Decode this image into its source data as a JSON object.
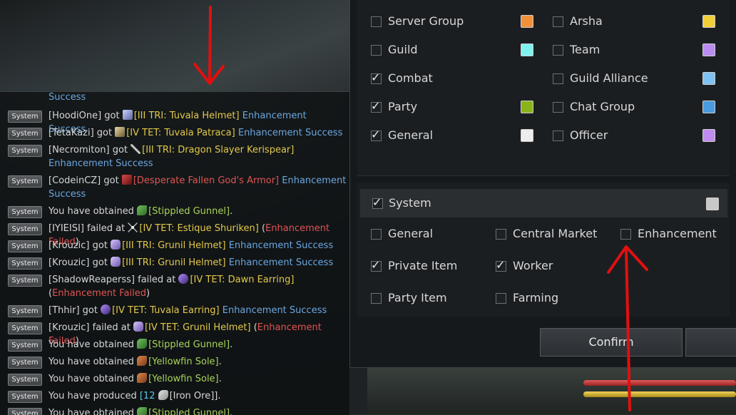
{
  "chat": {
    "lines": [
      {
        "tag": "System",
        "parts": [
          [
            "c-name",
            "[HoodiOne] got "
          ],
          [
            "ico helm",
            ""
          ],
          [
            "c-yellow",
            "[III TRI: Tuvala Helmet]"
          ],
          [
            "c-blue",
            " Enhancement Success"
          ]
        ]
      },
      {
        "tag": "System",
        "parts": [
          [
            "c-name",
            "[TetaKazi] got "
          ],
          [
            "ico boots",
            ""
          ],
          [
            "c-yellow",
            "[IV TET: Tuvala Patraca]"
          ],
          [
            "c-blue",
            " Enhancement Success"
          ]
        ]
      },
      {
        "tag": "System",
        "parts": [
          [
            "c-name",
            "[Necromiton] got "
          ],
          [
            "ico spear",
            ""
          ],
          [
            "c-yellow",
            "[III TRI: Dragon Slayer Kerispear]"
          ],
          [
            "c-blue",
            " Enhancement Success"
          ]
        ]
      },
      {
        "tag": "System",
        "parts": [
          [
            "c-name",
            "[CodeinCZ] got "
          ],
          [
            "ico armor",
            ""
          ],
          [
            "c-red",
            "[Desperate Fallen God's Armor]"
          ],
          [
            "c-blue",
            " Enhancement Success"
          ]
        ]
      },
      {
        "tag": "System",
        "parts": [
          [
            "c-name",
            "You have obtained "
          ],
          [
            "ico fish-g",
            ""
          ],
          [
            "c-green",
            "[Stippled Gunnel]"
          ],
          [
            "c-name",
            "."
          ]
        ]
      },
      {
        "tag": "System",
        "parts": [
          [
            "c-name",
            "[IYIEISI] failed at "
          ],
          [
            "ico shuriken",
            ""
          ],
          [
            "c-yellow",
            "[IV TET: Estique Shuriken]"
          ],
          [
            "c-name",
            " ("
          ],
          [
            "c-red",
            "Enhancement Failed"
          ],
          [
            "c-name",
            ")"
          ]
        ]
      },
      {
        "tag": "System",
        "parts": [
          [
            "c-name",
            "[Krouzic] got "
          ],
          [
            "ico crystal",
            ""
          ],
          [
            "c-yellow",
            "[III TRI: Grunil Helmet]"
          ],
          [
            "c-blue",
            " Enhancement Success"
          ]
        ]
      },
      {
        "tag": "System",
        "parts": [
          [
            "c-name",
            "[Krouzic] got "
          ],
          [
            "ico crystal",
            ""
          ],
          [
            "c-yellow",
            "[III TRI: Grunil Helmet]"
          ],
          [
            "c-blue",
            " Enhancement Success"
          ]
        ]
      },
      {
        "tag": "System",
        "parts": [
          [
            "c-name",
            "[ShadowReaperss] failed at "
          ],
          [
            "ico earring",
            ""
          ],
          [
            "c-yellow",
            "[IV TET: Dawn Earring]"
          ],
          [
            "c-name",
            " ("
          ],
          [
            "c-red",
            "Enhancement Failed"
          ],
          [
            "c-name",
            ")"
          ]
        ]
      },
      {
        "tag": "System",
        "parts": [
          [
            "c-name",
            "[Thhir] got "
          ],
          [
            "ico earring",
            ""
          ],
          [
            "c-yellow",
            "[IV TET: Tuvala Earring]"
          ],
          [
            "c-blue",
            " Enhancement Success"
          ]
        ]
      },
      {
        "tag": "System",
        "parts": [
          [
            "c-name",
            "[Krouzic] failed at "
          ],
          [
            "ico crystal",
            ""
          ],
          [
            "c-yellow",
            "[IV TET: Grunil Helmet]"
          ],
          [
            "c-name",
            " ("
          ],
          [
            "c-red",
            "Enhancement Failed"
          ],
          [
            "c-name",
            ")"
          ]
        ]
      },
      {
        "tag": "System",
        "parts": [
          [
            "c-name",
            "You have obtained "
          ],
          [
            "ico fish-g",
            ""
          ],
          [
            "c-green",
            "[Stippled Gunnel]"
          ],
          [
            "c-name",
            "."
          ]
        ]
      },
      {
        "tag": "System",
        "parts": [
          [
            "c-name",
            "You have obtained "
          ],
          [
            "ico fish-o",
            ""
          ],
          [
            "c-green",
            "[Yellowfin Sole]"
          ],
          [
            "c-name",
            "."
          ]
        ]
      },
      {
        "tag": "System",
        "parts": [
          [
            "c-name",
            "You have obtained "
          ],
          [
            "ico fish-o",
            ""
          ],
          [
            "c-green",
            "[Yellowfin Sole]"
          ],
          [
            "c-name",
            "."
          ]
        ]
      },
      {
        "tag": "System",
        "parts": [
          [
            "c-name",
            "You have produced "
          ],
          [
            "c-cyan",
            "[12 "
          ],
          [
            "ico ore",
            ""
          ],
          [
            "c-name",
            "[Iron Ore]]."
          ]
        ]
      },
      {
        "tag": "System",
        "parts": [
          [
            "c-name",
            "You have obtained "
          ],
          [
            "ico fish-g",
            ""
          ],
          [
            "c-green",
            "[Stippled Gunnel]"
          ],
          [
            "c-name",
            "."
          ]
        ]
      }
    ],
    "partial_top": "Success"
  },
  "filters_top": [
    {
      "label": "Server Group",
      "checked": false,
      "color": "#f0903a"
    },
    {
      "label": "Guild",
      "checked": false,
      "color": "#7ff2f0"
    },
    {
      "label": "Combat",
      "checked": true,
      "color": null
    },
    {
      "label": "Party",
      "checked": true,
      "color": "#8bb31a"
    },
    {
      "label": "General",
      "checked": true,
      "color": "#ededed"
    }
  ],
  "filters_right": [
    {
      "label": "Arsha",
      "checked": false,
      "color": "#f2cf3a"
    },
    {
      "label": "Team",
      "checked": false,
      "color": "#b98cf0"
    },
    {
      "label": "Guild Alliance",
      "checked": false,
      "color": "#7fc2f2"
    },
    {
      "label": "Chat Group",
      "checked": false,
      "color": "#4a9be0"
    },
    {
      "label": "Officer",
      "checked": false,
      "color": "#c08cf0"
    }
  ],
  "system": {
    "label": "System",
    "checked": true,
    "color": "#c8c8c8"
  },
  "system_subfilters": [
    {
      "label": "General",
      "checked": false
    },
    {
      "label": "Central Market",
      "checked": false
    },
    {
      "label": "Enhancement",
      "checked": false
    },
    {
      "label": "Private Item",
      "checked": true
    },
    {
      "label": "Worker",
      "checked": true
    },
    {
      "label": "Party Item",
      "checked": false
    },
    {
      "label": "Farming",
      "checked": false
    }
  ],
  "buttons": {
    "confirm": "Confirm"
  }
}
